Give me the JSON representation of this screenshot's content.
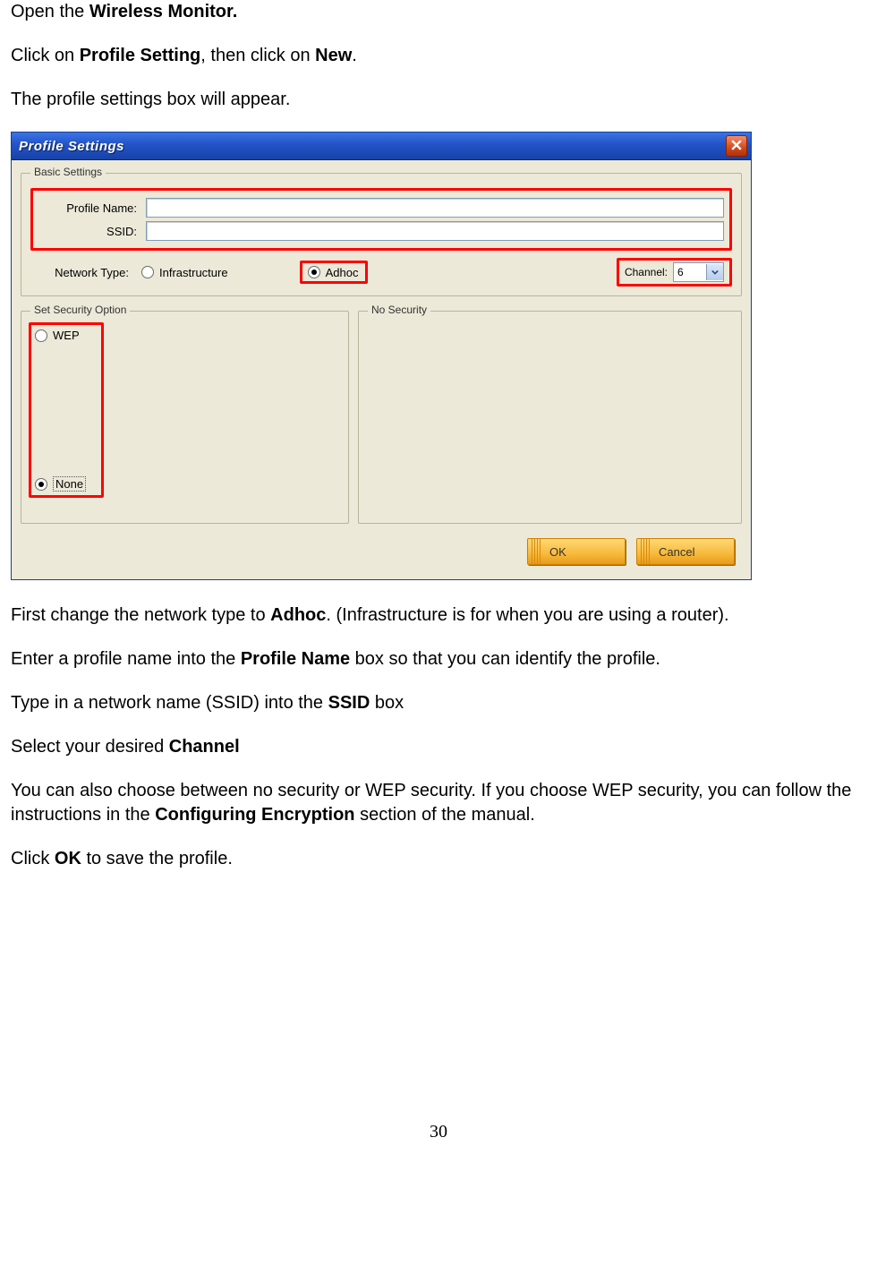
{
  "doc": {
    "p1_a": "Open the ",
    "p1_b": "Wireless Monitor.",
    "p2_a": "Click on ",
    "p2_b": "Profile Setting",
    "p2_c": ", then click on ",
    "p2_d": "New",
    "p2_e": ".",
    "p3": "The profile settings box will appear.",
    "p4_a": "First change the network type to ",
    "p4_b": "Adhoc",
    "p4_c": ".  (Infrastructure is for when you are using a router).",
    "p5_a": "Enter a profile name into the ",
    "p5_b": "Profile Name",
    "p5_c": " box so that you can identify the profile.",
    "p6_a": "Type in a network name (SSID) into the ",
    "p6_b": "SSID",
    "p6_c": " box",
    "p7_a": "Select your desired ",
    "p7_b": "Channel",
    "p8_a": "You can also choose between no security or WEP security.  If you choose WEP security, you can follow the instructions in the ",
    "p8_b": "Configuring Encryption",
    "p8_c": " section of the manual.",
    "p9_a": "Click ",
    "p9_b": "OK",
    "p9_c": " to save the profile.",
    "page_number": "30"
  },
  "win": {
    "title": "Profile Settings",
    "basic": {
      "legend": "Basic Settings",
      "profile_label": "Profile Name:",
      "profile_value": "",
      "ssid_label": "SSID:",
      "ssid_value": "",
      "net_type_label": "Network Type:",
      "infra_label": "Infrastructure",
      "adhoc_label": "Adhoc",
      "channel_label": "Channel:",
      "channel_value": "6"
    },
    "sec_left_legend": "Set Security Option",
    "sec_right_legend": "No Security",
    "wep_label": "WEP",
    "none_label": "None",
    "ok_label": "OK",
    "cancel_label": "Cancel"
  }
}
